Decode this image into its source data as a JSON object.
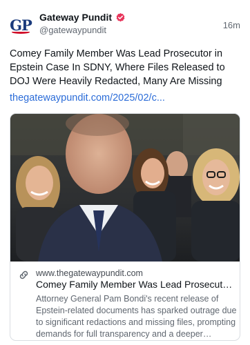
{
  "post": {
    "author": {
      "display_name": "Gateway Pundit",
      "handle": "@gatewaypundit",
      "avatar_logo_text": "GP",
      "verified_icon": "verified-badge-icon"
    },
    "timestamp": "16m",
    "text": "Comey Family Member Was Lead Prosecutor in Epstein Case In SDNY, Where Files Released to DOJ Were Heavily Redacted, Many Are Missing",
    "link_text": "thegatewaypundit.com/2025/02/c..."
  },
  "card": {
    "image": "photo of a man in a suit in the foreground with smiling women seated behind him",
    "icon": "link-icon",
    "domain": "www.thegatewaypundit.com",
    "title": "Comey Family Member Was Lead Prosecutor i...",
    "description": "Attorney General Pam Bondi's recent release of Epstein-related documents has sparked outrage due to significant redactions and missing files, prompting demands for full transparency and a deeper investiga..."
  },
  "colors": {
    "link": "#2b6cd8",
    "verified_badge": "#e8355b",
    "logo_blue": "#1a3a7c",
    "logo_red": "#d0102a"
  }
}
